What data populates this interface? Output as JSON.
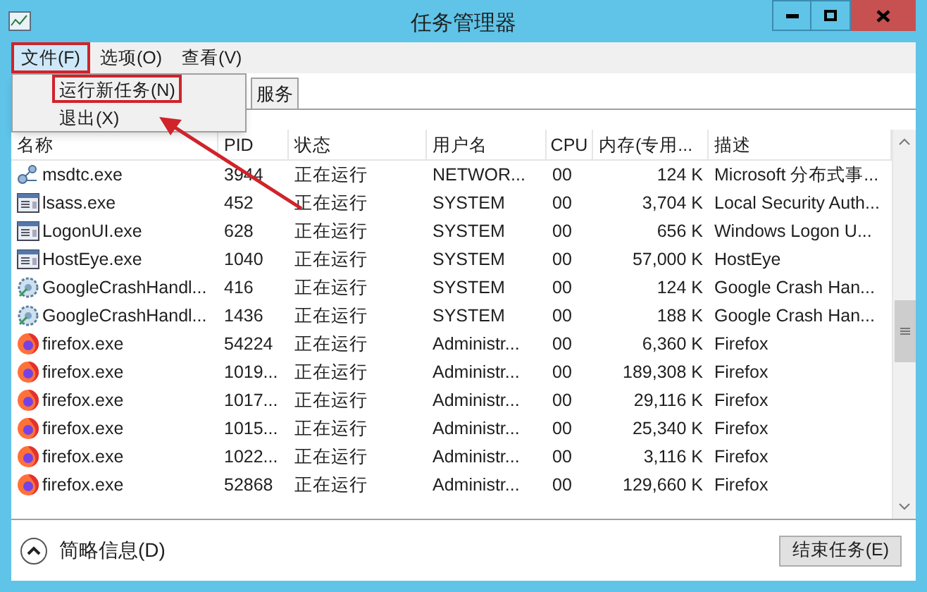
{
  "window": {
    "title": "任务管理器"
  },
  "menu_bar": [
    {
      "label": "文件(F)",
      "annotated": true
    },
    {
      "label": "选项(O)",
      "annotated": false
    },
    {
      "label": "查看(V)",
      "annotated": false
    }
  ],
  "open_menu": {
    "items": [
      {
        "label": "运行新任务(N)",
        "annotated": true
      },
      {
        "label": "退出(X)",
        "annotated": false
      }
    ]
  },
  "tabs": [
    {
      "label": "服务",
      "selected": false
    }
  ],
  "table": {
    "columns": [
      "名称",
      "PID",
      "状态",
      "用户名",
      "CPU",
      "内存(专用...",
      "描述"
    ],
    "rows": [
      {
        "kind": "service",
        "cells": [
          "msdtc.exe",
          "3944",
          "正在运行",
          "NETWOR...",
          "00",
          "124 K",
          "Microsoft 分布式事..."
        ]
      },
      {
        "kind": "window",
        "cells": [
          "lsass.exe",
          "452",
          "正在运行",
          "SYSTEM",
          "00",
          "3,704 K",
          "Local Security Auth..."
        ]
      },
      {
        "kind": "window",
        "cells": [
          "LogonUI.exe",
          "628",
          "正在运行",
          "SYSTEM",
          "00",
          "656 K",
          "Windows Logon U..."
        ]
      },
      {
        "kind": "window",
        "cells": [
          "HostEye.exe",
          "1040",
          "正在运行",
          "SYSTEM",
          "00",
          "57,000 K",
          "HostEye"
        ]
      },
      {
        "kind": "crash",
        "cells": [
          "GoogleCrashHandl...",
          "416",
          "正在运行",
          "SYSTEM",
          "00",
          "124 K",
          "Google Crash Han..."
        ]
      },
      {
        "kind": "crash",
        "cells": [
          "GoogleCrashHandl...",
          "1436",
          "正在运行",
          "SYSTEM",
          "00",
          "188 K",
          "Google Crash Han..."
        ]
      },
      {
        "kind": "firefox",
        "cells": [
          "firefox.exe",
          "54224",
          "正在运行",
          "Administr...",
          "00",
          "6,360 K",
          "Firefox"
        ]
      },
      {
        "kind": "firefox",
        "cells": [
          "firefox.exe",
          "1019...",
          "正在运行",
          "Administr...",
          "00",
          "189,308 K",
          "Firefox"
        ]
      },
      {
        "kind": "firefox",
        "cells": [
          "firefox.exe",
          "1017...",
          "正在运行",
          "Administr...",
          "00",
          "29,116 K",
          "Firefox"
        ]
      },
      {
        "kind": "firefox",
        "cells": [
          "firefox.exe",
          "1015...",
          "正在运行",
          "Administr...",
          "00",
          "25,340 K",
          "Firefox"
        ]
      },
      {
        "kind": "firefox",
        "cells": [
          "firefox.exe",
          "1022...",
          "正在运行",
          "Administr...",
          "00",
          "3,116 K",
          "Firefox"
        ]
      },
      {
        "kind": "firefox",
        "cells": [
          "firefox.exe",
          "52868",
          "正在运行",
          "Administr...",
          "00",
          "129,660 K",
          "Firefox"
        ]
      }
    ]
  },
  "footer": {
    "details_toggle": "简略信息(D)",
    "end_task_button": "结束任务(E)"
  }
}
